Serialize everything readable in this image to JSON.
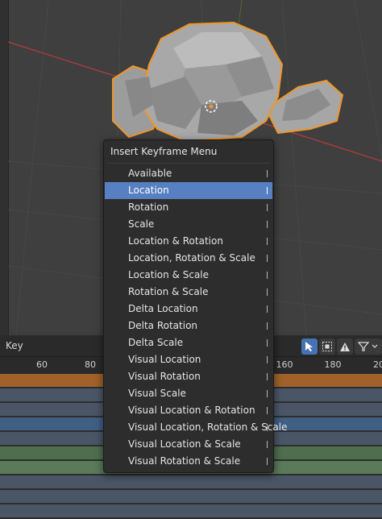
{
  "menu": {
    "title": "Insert Keyframe Menu",
    "items": [
      {
        "label": "Available"
      },
      {
        "label": "Location"
      },
      {
        "label": "Rotation"
      },
      {
        "label": "Scale"
      },
      {
        "label": "Location & Rotation"
      },
      {
        "label": "Location, Rotation & Scale"
      },
      {
        "label": "Location & Scale"
      },
      {
        "label": "Rotation & Scale"
      },
      {
        "label": "Delta Location"
      },
      {
        "label": "Delta Rotation"
      },
      {
        "label": "Delta Scale"
      },
      {
        "label": "Visual Location"
      },
      {
        "label": "Visual Rotation"
      },
      {
        "label": "Visual Scale"
      },
      {
        "label": "Visual Location & Rotation"
      },
      {
        "label": "Visual Location, Rotation & Scale"
      },
      {
        "label": "Visual Location & Scale"
      },
      {
        "label": "Visual Rotation & Scale"
      }
    ],
    "highlighted_index": 1
  },
  "timeline": {
    "header_label": "Key",
    "ruler": [
      "60",
      "80",
      "160",
      "180",
      "20"
    ],
    "icons": [
      "select-cursor-icon",
      "box-select-icon",
      "warning-icon",
      "filter-icon"
    ],
    "channel_colors": [
      "#a0622a",
      "#4a5566",
      "#4a5566",
      "#3f5f85",
      "#4a5566",
      "#4e6e4e",
      "#5a7a5a",
      "#4a5566",
      "#4a5566",
      "#4a5566"
    ]
  },
  "colors": {
    "selection_outline": "#f0962a",
    "menu_highlight": "#5680c2",
    "x_axis": "#b23b3b",
    "y_axis": "#6b8e23"
  }
}
